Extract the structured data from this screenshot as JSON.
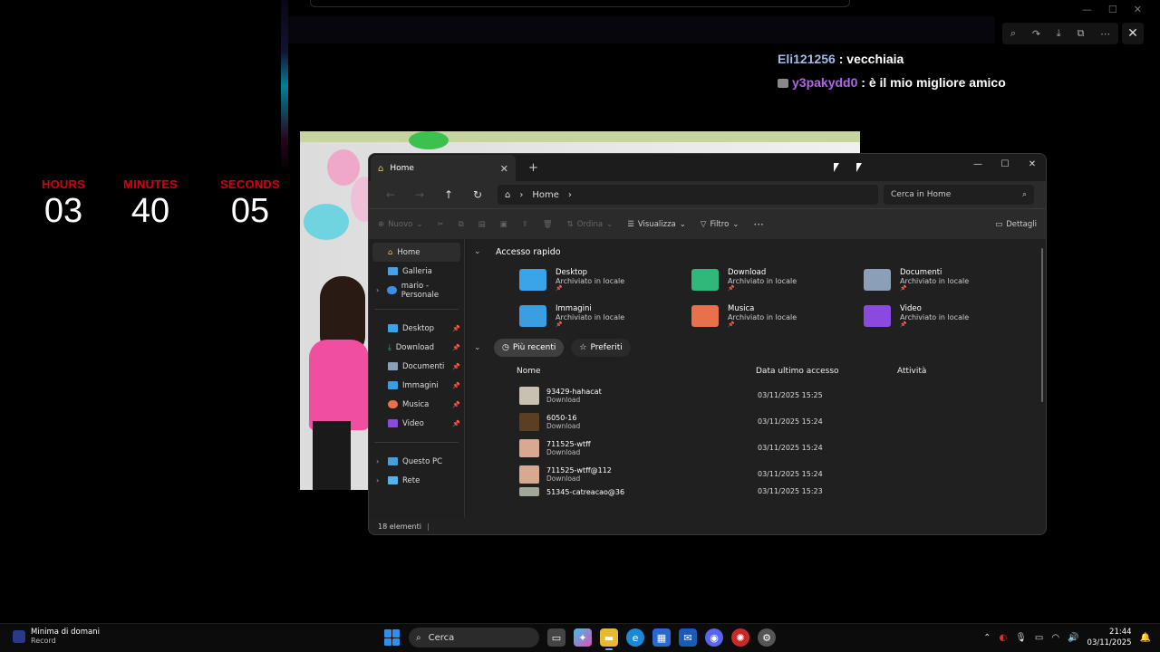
{
  "countdown": {
    "hours_label": "HOURS",
    "hours": "03",
    "minutes_label": "MINUTES",
    "minutes": "40",
    "seconds_label": "SECONDS",
    "seconds": "05"
  },
  "chat": [
    {
      "user": "Eli121256",
      "sep": " : ",
      "text": "vecchiaia"
    },
    {
      "user": "y3pakydd0",
      "sep": " : ",
      "text": "è il mio migliore amico"
    }
  ],
  "explorer": {
    "tab_title": "Home",
    "breadcrumb": "Home",
    "search_placeholder": "Cerca in Home",
    "toolbar": {
      "new": "Nuovo",
      "sort": "Ordina",
      "view": "Visualizza",
      "filter": "Filtro",
      "more": "···",
      "details": "Dettagli"
    },
    "nav": {
      "home": "Home",
      "gallery": "Galleria",
      "onedrive": "mario - Personale",
      "desktop": "Desktop",
      "download": "Download",
      "documents": "Documenti",
      "images": "Immagini",
      "music": "Musica",
      "video": "Video",
      "this_pc": "Questo PC",
      "network": "Rete"
    },
    "quick_access": {
      "title": "Accesso rapido",
      "items": [
        {
          "name": "Desktop",
          "sub": "Archiviato in locale",
          "color": "#3ba4e8"
        },
        {
          "name": "Download",
          "sub": "Archiviato in locale",
          "color": "#2fb87a"
        },
        {
          "name": "Documenti",
          "sub": "Archiviato in locale",
          "color": "#8b9fb8"
        },
        {
          "name": "Immagini",
          "sub": "Archiviato in locale",
          "color": "#3a9ee0"
        },
        {
          "name": "Musica",
          "sub": "Archiviato in locale",
          "color": "#e8704a"
        },
        {
          "name": "Video",
          "sub": "Archiviato in locale",
          "color": "#8a4ae0"
        }
      ]
    },
    "filters": {
      "recent": "Più recenti",
      "favorites": "Preferiti"
    },
    "columns": {
      "name": "Nome",
      "date": "Data ultimo accesso",
      "activity": "Attività"
    },
    "files": [
      {
        "name": "93429-hahacat",
        "location": "Download",
        "date": "03/11/2025 15:25",
        "color": "#c8c0b0"
      },
      {
        "name": "6050-16",
        "location": "Download",
        "date": "03/11/2025 15:24",
        "color": "#5a4020"
      },
      {
        "name": "711525-wtff",
        "location": "Download",
        "date": "03/11/2025 15:24",
        "color": "#d8a890"
      },
      {
        "name": "711525-wtff@112",
        "location": "Download",
        "date": "03/11/2025 15:24",
        "color": "#d8a890"
      },
      {
        "name": "51345-catreacao@36",
        "location": "Download",
        "date": "03/11/2025 15:23",
        "color": "#a0a898"
      }
    ],
    "status": "18 elementi"
  },
  "taskbar": {
    "media_title": "Minima di domani",
    "media_sub": "Record",
    "search_placeholder": "Cerca",
    "time": "21:44",
    "date": "03/11/2025"
  },
  "colors": {
    "countdown_label": "#d4000f",
    "chat_user1": "#a8b8e8",
    "chat_user2": "#b066e8"
  }
}
